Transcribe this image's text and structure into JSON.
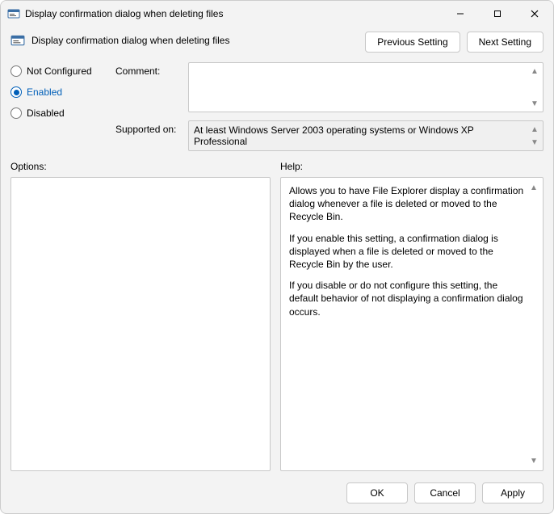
{
  "window": {
    "title": "Display confirmation dialog when deleting files"
  },
  "header": {
    "policy_name": "Display confirmation dialog when deleting files"
  },
  "nav": {
    "previous": "Previous Setting",
    "next": "Next Setting"
  },
  "state": {
    "options": [
      "Not Configured",
      "Enabled",
      "Disabled"
    ],
    "selected": "Enabled"
  },
  "fields": {
    "comment_label": "Comment:",
    "comment_value": "",
    "supported_label": "Supported on:",
    "supported_value": "At least Windows Server 2003 operating systems or Windows XP Professional"
  },
  "panels": {
    "options_label": "Options:",
    "help_label": "Help:",
    "help_paragraphs": [
      "Allows you to have File Explorer display a confirmation dialog whenever a file is deleted or moved to the Recycle Bin.",
      "If you enable this setting, a confirmation dialog is displayed when a file is deleted or moved to the Recycle Bin by the user.",
      "If you disable or do not configure this setting, the default behavior of not displaying a confirmation dialog occurs."
    ]
  },
  "footer": {
    "ok": "OK",
    "cancel": "Cancel",
    "apply": "Apply"
  }
}
